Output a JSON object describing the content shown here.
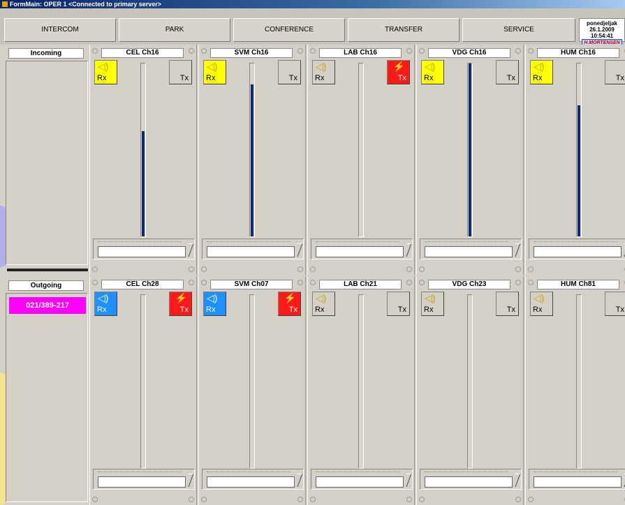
{
  "window": {
    "title": "FormMain: OPER 1   <Connected to primary server>"
  },
  "nav": {
    "intercom": "INTERCOM",
    "park": "PARK",
    "conference": "CONFERENCE",
    "transfer": "TRANSFER",
    "service": "SERVICE"
  },
  "datetime": {
    "day": "ponedjeljak",
    "date": "26.1.2009",
    "time": "10:54:41",
    "brand": "H.MORTENSEN"
  },
  "incoming": {
    "label": "Incoming"
  },
  "outgoing": {
    "label": "Outgoing",
    "call_number": "021/389-217"
  },
  "button_labels": {
    "rx": "Rx",
    "tx": "Tx"
  },
  "colors": {
    "rx_active_incoming": "#ffff00",
    "rx_active_outgoing": "#1e90ff",
    "tx_active": "#ff1a1a",
    "level_bar": "#0b2a7a",
    "call_number_bg": "#ff00ff"
  },
  "incoming_channels": [
    {
      "name": "CEL Ch16",
      "rx": "yellow",
      "tx": "gray",
      "level": 0.61
    },
    {
      "name": "SVM Ch16",
      "rx": "yellow",
      "tx": "gray",
      "level": 0.88
    },
    {
      "name": "LAB Ch16",
      "rx": "gray",
      "tx": "red",
      "level": 0
    },
    {
      "name": "VDG Ch16",
      "rx": "yellow",
      "tx": "gray",
      "level": 1.0
    },
    {
      "name": "HUM Ch16",
      "rx": "yellow",
      "tx": "gray",
      "level": 0.76
    }
  ],
  "outgoing_channels": [
    {
      "name": "CEL Ch28",
      "rx": "blue",
      "tx": "red"
    },
    {
      "name": "SVM Ch07",
      "rx": "blue",
      "tx": "red"
    },
    {
      "name": "LAB Ch21",
      "rx": "gray",
      "tx": "gray"
    },
    {
      "name": "VDG Ch23",
      "rx": "gray",
      "tx": "gray"
    },
    {
      "name": "HUM Ch81",
      "rx": "gray",
      "tx": "gray"
    }
  ]
}
